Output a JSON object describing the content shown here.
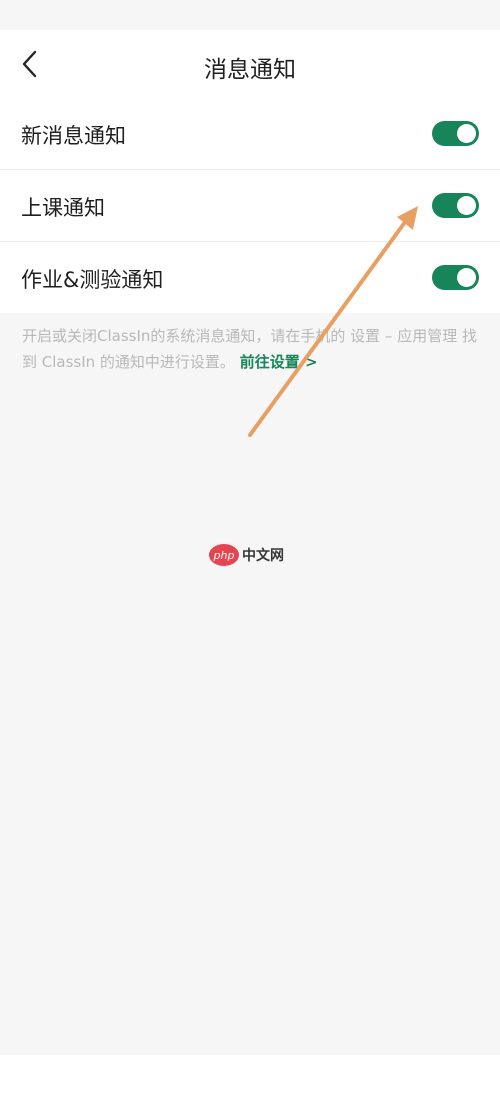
{
  "header": {
    "title": "消息通知",
    "back_icon": "chevron-left-icon"
  },
  "settings": [
    {
      "label": "新消息通知",
      "enabled": true
    },
    {
      "label": "上课通知",
      "enabled": true
    },
    {
      "label": "作业&测验通知",
      "enabled": true
    }
  ],
  "hint": {
    "text": "开启或关闭ClassIn的系统消息通知，请在手机的 设置 – 应用管理 找到 ClassIn 的通知中进行设置。",
    "link_label": "前往设置 >"
  },
  "watermark": {
    "logo_text": "php",
    "text": "中文网"
  },
  "colors": {
    "accent": "#17845a",
    "page_background": "#f6f6f6",
    "card_background": "#ffffff",
    "hint_text": "#b8b8b8",
    "arrow": "#e8a062"
  }
}
